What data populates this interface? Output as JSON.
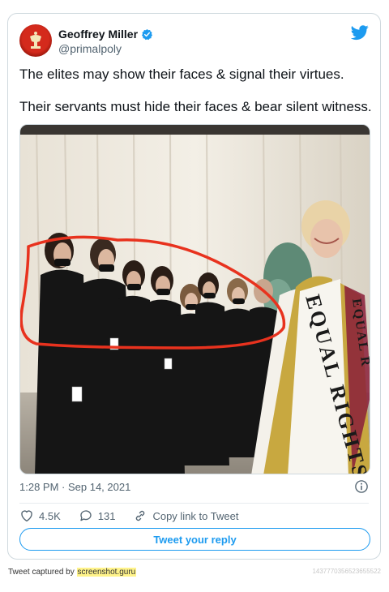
{
  "author": {
    "name": "Geoffrey Miller",
    "handle": "@primalpoly"
  },
  "tweet": {
    "line1": "The elites may show their faces &  signal their virtues.",
    "line2": "Their servants must hide their faces & bear silent witness.",
    "timestamp": "1:28 PM · Sep 14, 2021",
    "likes": "4.5K",
    "replies": "131",
    "copy_link": "Copy link to Tweet",
    "reply_button": "Tweet your reply"
  },
  "media": {
    "sash_text": "EQUAL RIGHTS",
    "sash_text_2": "EQUAL R"
  },
  "footer": {
    "prefix": "Tweet captured by ",
    "brand": "screenshot.guru",
    "tweet_id": "1437770356523655522"
  },
  "colors": {
    "accent": "#1d9bf0",
    "annotation": "#e8321e"
  },
  "icons": [
    "avatar-logo",
    "verified-badge-icon",
    "twitter-bird-icon",
    "info-icon",
    "heart-icon",
    "reply-icon",
    "link-icon"
  ]
}
